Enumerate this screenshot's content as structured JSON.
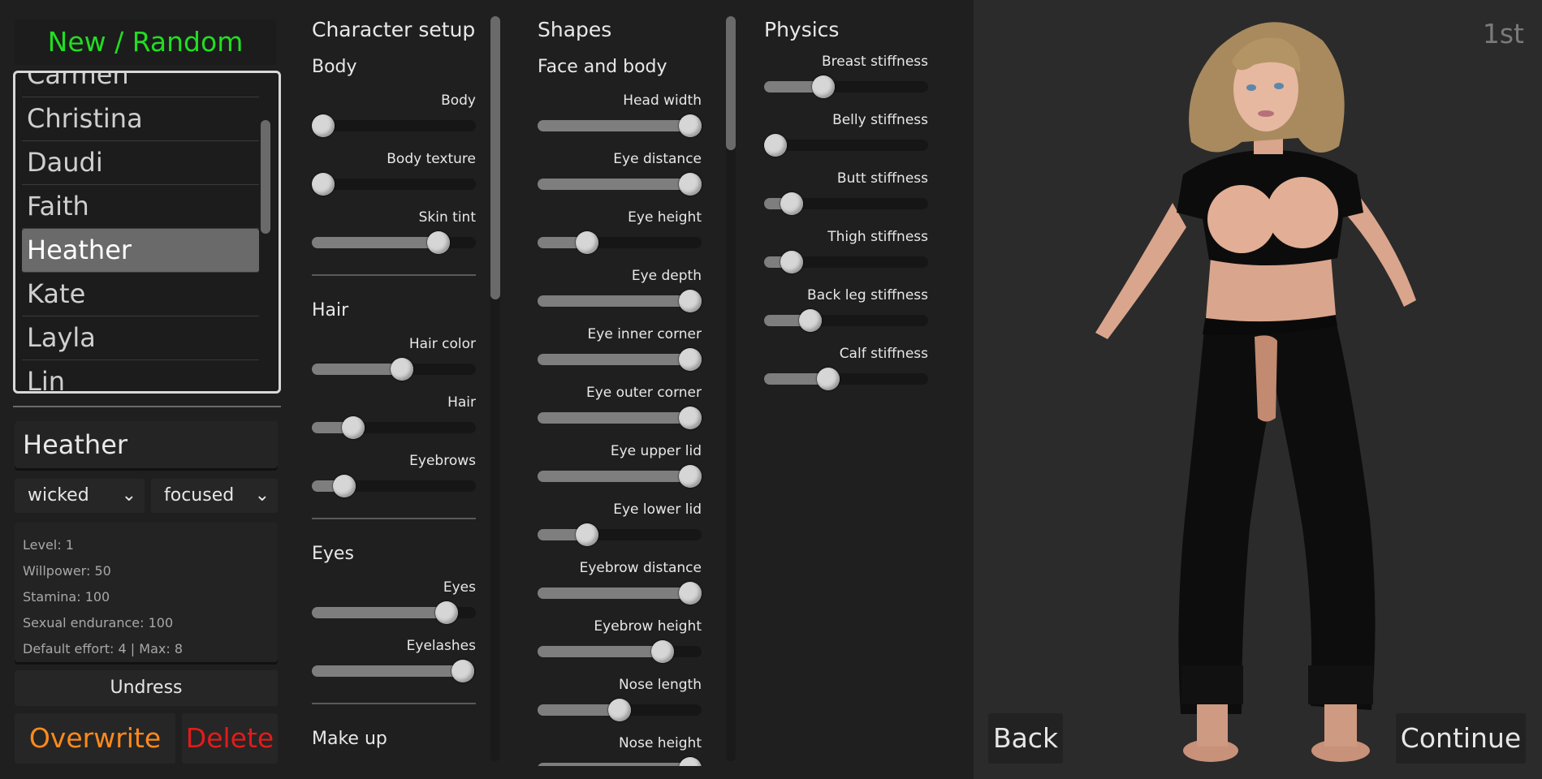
{
  "character_list": {
    "new_random_label": "New / Random",
    "names": [
      "Carmen",
      "Christina",
      "Daudi",
      "Faith",
      "Heather",
      "Kate",
      "Layla",
      "Lin"
    ],
    "selected": "Heather"
  },
  "character_details": {
    "name": "Heather",
    "mood": "wicked",
    "focus": "focused",
    "stats": [
      "Level: 1",
      "Willpower: 50",
      "Stamina: 100",
      "Sexual endurance: 100",
      "Default effort: 4 | Max: 8"
    ]
  },
  "buttons": {
    "undress": "Undress",
    "overwrite": "Overwrite",
    "delete": "Delete",
    "back": "Back",
    "continue": "Continue"
  },
  "view_label": "1st",
  "columns": [
    {
      "title": "Character setup",
      "scroll_fraction": 0.38,
      "sections": [
        {
          "title": "Body",
          "sliders": [
            {
              "label": "Body",
              "value": 0.07
            },
            {
              "label": "Body texture",
              "value": 0.07
            },
            {
              "label": "Skin tint",
              "value": 0.77
            }
          ]
        },
        {
          "title": "Hair",
          "sliders": [
            {
              "label": "Hair color",
              "value": 0.55
            },
            {
              "label": "Hair",
              "value": 0.25
            },
            {
              "label": "Eyebrows",
              "value": 0.2
            }
          ]
        },
        {
          "title": "Eyes",
          "sliders": [
            {
              "label": "Eyes",
              "value": 0.82
            },
            {
              "label": "Eyelashes",
              "value": 0.92
            }
          ]
        },
        {
          "title": "Make up",
          "sliders": []
        }
      ]
    },
    {
      "title": "Shapes",
      "scroll_fraction": 0.18,
      "sections": [
        {
          "title": "Face and body",
          "sliders": [
            {
              "label": "Head width",
              "value": 0.93
            },
            {
              "label": "Eye distance",
              "value": 0.93
            },
            {
              "label": "Eye height",
              "value": 0.3
            },
            {
              "label": "Eye depth",
              "value": 0.93
            },
            {
              "label": "Eye inner corner",
              "value": 0.93
            },
            {
              "label": "Eye outer corner",
              "value": 0.93
            },
            {
              "label": "Eye upper lid",
              "value": 0.93
            },
            {
              "label": "Eye lower lid",
              "value": 0.3
            },
            {
              "label": "Eyebrow distance",
              "value": 0.93
            },
            {
              "label": "Eyebrow height",
              "value": 0.76
            },
            {
              "label": "Nose length",
              "value": 0.5
            },
            {
              "label": "Nose height",
              "value": 0.93
            }
          ]
        }
      ]
    },
    {
      "title": "Physics",
      "scroll_fraction": null,
      "sections": [
        {
          "title": "",
          "sliders": [
            {
              "label": "Breast stiffness",
              "value": 0.36
            },
            {
              "label": "Belly stiffness",
              "value": 0.07
            },
            {
              "label": "Butt stiffness",
              "value": 0.17
            },
            {
              "label": "Thigh stiffness",
              "value": 0.17
            },
            {
              "label": "Back leg stiffness",
              "value": 0.28
            },
            {
              "label": "Calf stiffness",
              "value": 0.39
            }
          ]
        }
      ]
    }
  ],
  "colors": {
    "new_random": "#22dd22",
    "overwrite": "#ff8a1a",
    "delete": "#e21b1b"
  }
}
